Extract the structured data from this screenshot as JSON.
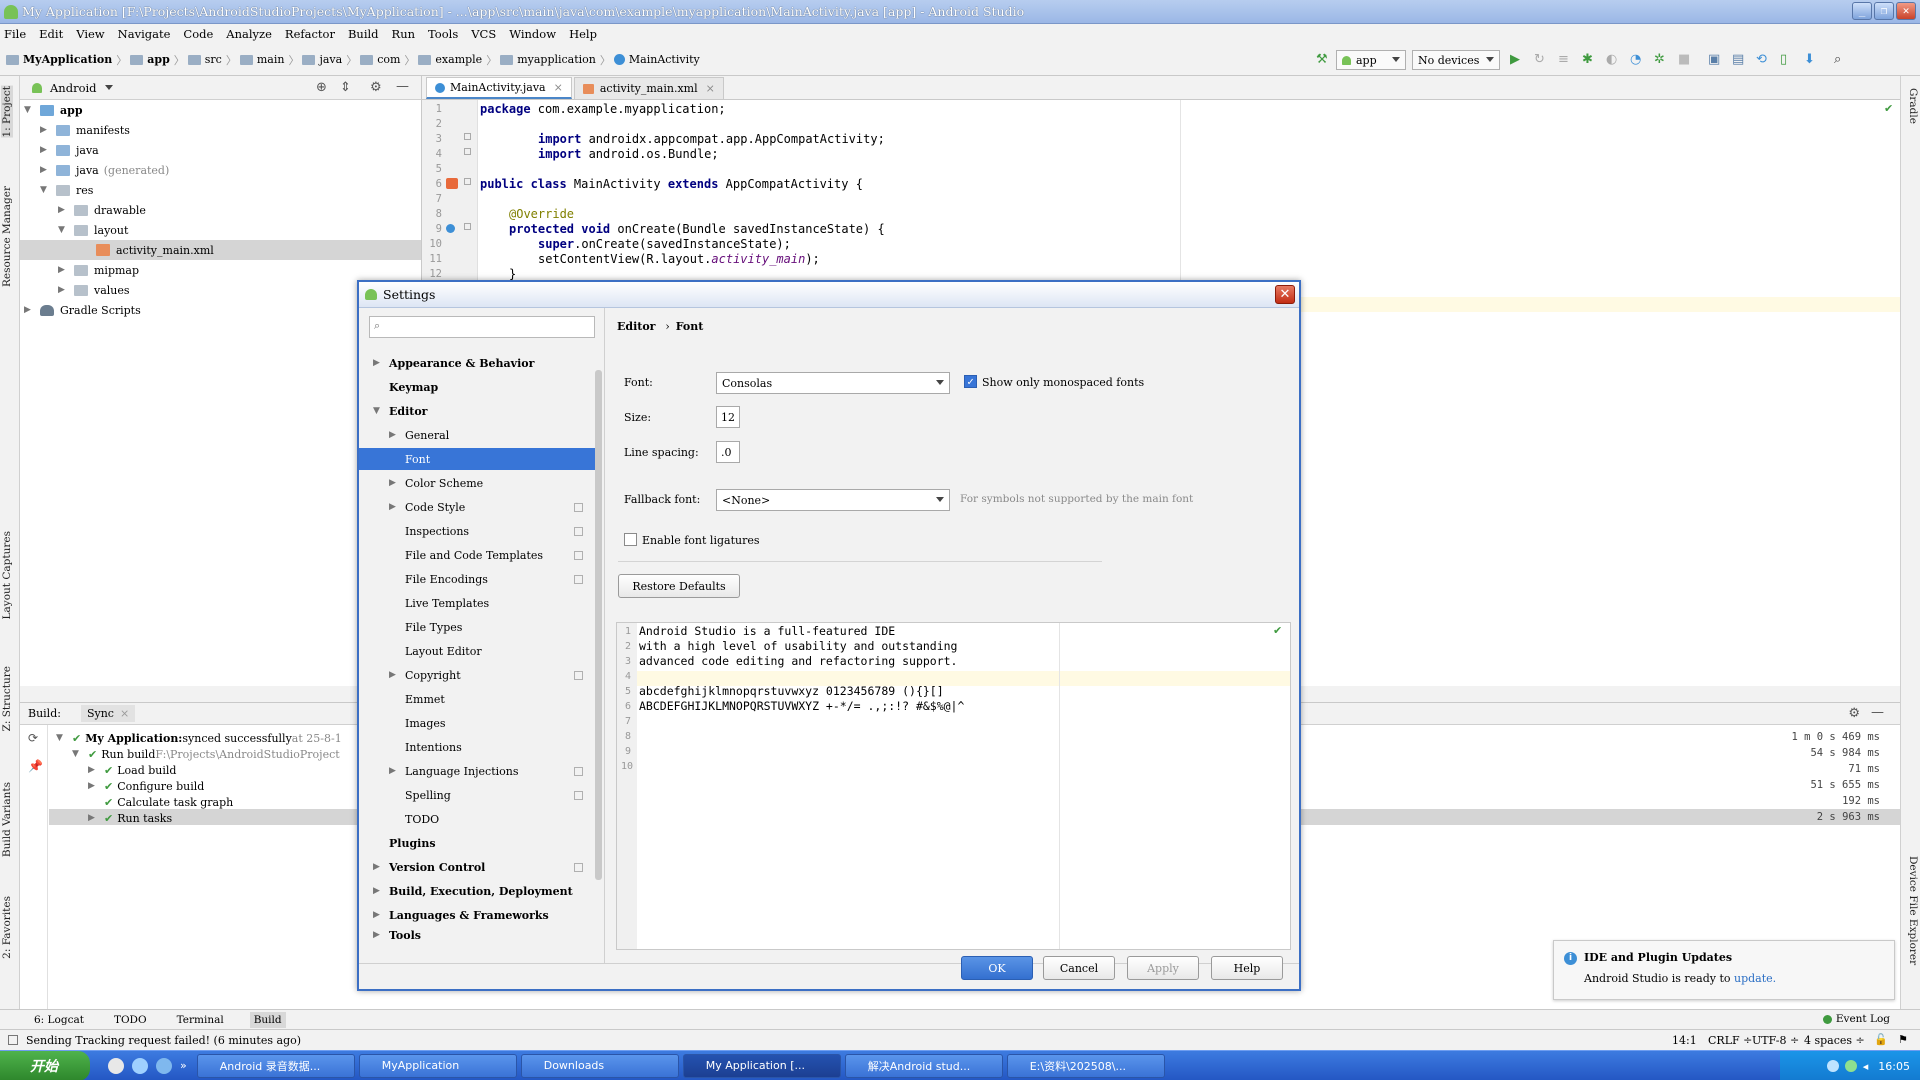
{
  "window": {
    "title": "My Application [F:\\Projects\\AndroidStudioProjects\\MyApplication] - ...\\app\\src\\main\\java\\com\\example\\myapplication\\MainActivity.java [app] - Android Studio"
  },
  "menu": [
    "File",
    "Edit",
    "View",
    "Navigate",
    "Code",
    "Analyze",
    "Refactor",
    "Build",
    "Run",
    "Tools",
    "VCS",
    "Window",
    "Help"
  ],
  "breadcrumbs": [
    "MyApplication",
    "app",
    "src",
    "main",
    "java",
    "com",
    "example",
    "myapplication",
    "MainActivity"
  ],
  "toolbar": {
    "config": "app",
    "devices": "No devices"
  },
  "left_tool_tabs": [
    "1: Project",
    "Resource Manager",
    "Layout Captures",
    "Z: Structure",
    "Build Variants",
    "2: Favorites"
  ],
  "right_tool_tabs": [
    "Gradle",
    "Device File Explorer"
  ],
  "project": {
    "view": "Android",
    "tree": [
      {
        "label": "app"
      },
      {
        "label": "manifests"
      },
      {
        "label": "java"
      },
      {
        "label": "java",
        "suffix": "(generated)"
      },
      {
        "label": "res"
      },
      {
        "label": "drawable"
      },
      {
        "label": "layout"
      },
      {
        "label": "activity_main.xml"
      },
      {
        "label": "mipmap"
      },
      {
        "label": "values"
      },
      {
        "label": "Gradle Scripts"
      }
    ]
  },
  "editor": {
    "tabs": [
      "MainActivity.java",
      "activity_main.xml"
    ],
    "line_numbers": [
      "1",
      "2",
      "3",
      "4",
      "5",
      "6",
      "7",
      "8",
      "9",
      "10",
      "11",
      "12"
    ],
    "lines": {
      "l1_kw": "package",
      "l1": " com.example.myapplication;",
      "l3_kw": "import",
      "l3": " androidx.appcompat.app.AppCompatActivity;",
      "l4_kw": "import",
      "l4": " android.os.Bundle;",
      "l6_kw": "public class",
      "l6a": " MainActivity ",
      "l6_kw2": "extends",
      "l6b": " AppCompatActivity {",
      "l8_an": "@Override",
      "l9_kw": "protected void",
      "l9": " onCreate(Bundle savedInstanceState) {",
      "l10_kw": "super",
      "l10": ".onCreate(savedInstanceState);",
      "l11": "setContentView(R.layout.",
      "l11_it": "activity_main",
      "l11b": ");",
      "l12": "}"
    }
  },
  "build": {
    "tabs": [
      "Build:",
      "Sync"
    ],
    "rows": [
      {
        "name": "My Application:",
        "detail": " synced successfully",
        "extra": " at 25-8-1",
        "time": "1 m 0 s 469 ms"
      },
      {
        "name": "Run build",
        "detail": " F:\\Projects\\AndroidStudioProject",
        "time": "54 s 984 ms"
      },
      {
        "name": "Load build",
        "time": "71 ms"
      },
      {
        "name": "Configure build",
        "time": "51 s 655 ms"
      },
      {
        "name": "Calculate task graph",
        "time": "192 ms"
      },
      {
        "name": "Run tasks",
        "time": "2 s 963 ms"
      }
    ]
  },
  "bottom_tabs": [
    "6: Logcat",
    "TODO",
    "Terminal",
    "Build"
  ],
  "event_log": "Event Log",
  "status": {
    "message": "Sending Tracking request failed! (6 minutes ago)",
    "position": "14:1",
    "line_sep": "CRLF ÷",
    "encoding": "UTF-8 ÷",
    "indent": "4 spaces ÷"
  },
  "taskbar": {
    "start": "开始",
    "tasks": [
      "Android 录音数据...",
      "MyApplication",
      "Downloads",
      "My Application [...",
      "解决Android stud...",
      "E:\\资料\\202508\\..."
    ],
    "clock": "16:05"
  },
  "notification": {
    "title": "IDE and Plugin Updates",
    "body": "Android Studio is ready to ",
    "link": "update."
  },
  "settings": {
    "title": "Settings",
    "search_placeholder": "",
    "breadcrumb_parent": "Editor",
    "breadcrumb_sep": "›",
    "breadcrumb_current": "Font",
    "nav": [
      {
        "label": "Appearance & Behavior"
      },
      {
        "label": "Keymap"
      },
      {
        "label": "Editor"
      },
      {
        "label": "General"
      },
      {
        "label": "Font"
      },
      {
        "label": "Color Scheme"
      },
      {
        "label": "Code Style"
      },
      {
        "label": "Inspections"
      },
      {
        "label": "File and Code Templates"
      },
      {
        "label": "File Encodings"
      },
      {
        "label": "Live Templates"
      },
      {
        "label": "File Types"
      },
      {
        "label": "Layout Editor"
      },
      {
        "label": "Copyright"
      },
      {
        "label": "Emmet"
      },
      {
        "label": "Images"
      },
      {
        "label": "Intentions"
      },
      {
        "label": "Language Injections"
      },
      {
        "label": "Spelling"
      },
      {
        "label": "TODO"
      },
      {
        "label": "Plugins"
      },
      {
        "label": "Version Control"
      },
      {
        "label": "Build, Execution, Deployment"
      },
      {
        "label": "Languages & Frameworks"
      },
      {
        "label": "Tools"
      }
    ],
    "font_label": "Font:",
    "font_value": "Consolas",
    "monospaced_label": "Show only monospaced fonts",
    "monospaced_checked": true,
    "size_label": "Size:",
    "size_value": "12",
    "line_spacing_label": "Line spacing:",
    "line_spacing_value": ".0",
    "fallback_label": "Fallback font:",
    "fallback_value": "<None>",
    "fallback_hint": "For symbols not supported by the main font",
    "ligatures_label": "Enable font ligatures",
    "ligatures_checked": false,
    "restore_label": "Restore Defaults",
    "preview_line_numbers": [
      "1",
      "2",
      "3",
      "4",
      "5",
      "6",
      "7",
      "8",
      "9",
      "10"
    ],
    "preview_lines": [
      "Android Studio is a full-featured IDE",
      "with a high level of usability and outstanding",
      "advanced code editing and refactoring support.",
      "",
      "abcdefghijklmnopqrstuvwxyz 0123456789 (){}[]",
      "ABCDEFGHIJKLMNOPQRSTUVWXYZ +-*/= .,;:!? #&$%@|^"
    ],
    "ok_label": "OK",
    "cancel_label": "Cancel",
    "apply_label": "Apply",
    "help_label": "Help"
  },
  "colors": {
    "accent": "#3875d7",
    "title_bar": "#9bb7e6",
    "taskbar": "#2457c4"
  }
}
